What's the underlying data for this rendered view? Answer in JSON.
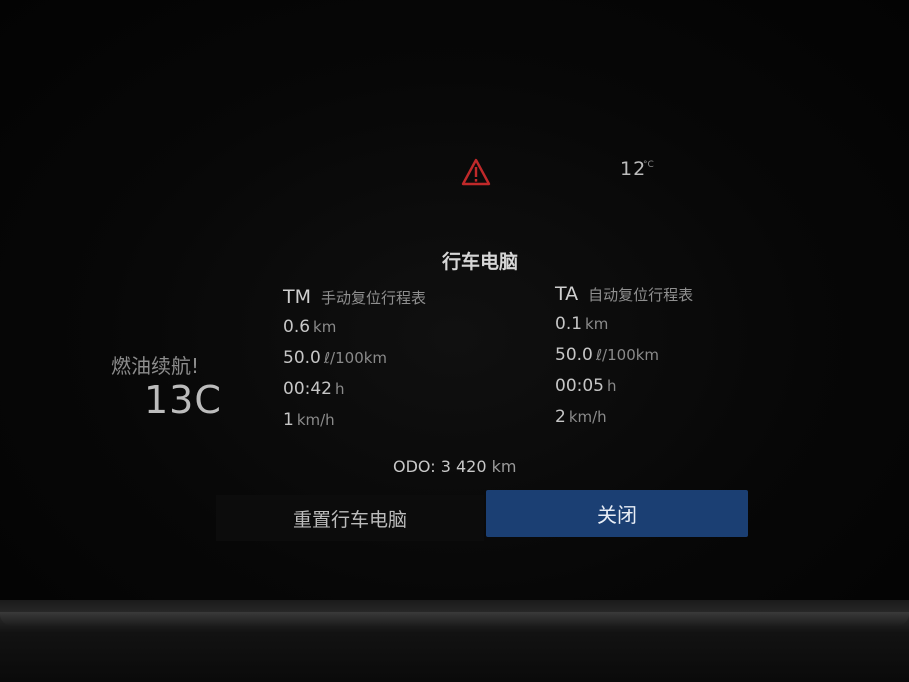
{
  "status_bar": {
    "warning_icon": "warning-triangle-icon",
    "warning_color": "#c0292a",
    "temperature": "12",
    "temperature_unit": "°C"
  },
  "range": {
    "label": "燃油续航!",
    "value": "13C"
  },
  "trip_computer": {
    "title": "行车电脑",
    "manual_trip": {
      "abbr": "TM",
      "name": "手动复位行程表",
      "distance": "0.6",
      "distance_unit": "km",
      "consumption": "50.0",
      "consumption_unit": "ℓ/100km",
      "time": "00:42",
      "time_unit": "h",
      "speed": "1",
      "speed_unit": "km/h"
    },
    "auto_trip": {
      "abbr": "TA",
      "name": "自动复位行程表",
      "distance": "0.1",
      "distance_unit": "km",
      "consumption": "50.0",
      "consumption_unit": "ℓ/100km",
      "time": "00:05",
      "time_unit": "h",
      "speed": "2",
      "speed_unit": "km/h"
    },
    "odometer": {
      "label": "ODO:",
      "value": "3 420",
      "unit": "km"
    }
  },
  "buttons": {
    "reset_label": "重置行车电脑",
    "close_label": "关闭",
    "close_color": "#1b3f73"
  }
}
